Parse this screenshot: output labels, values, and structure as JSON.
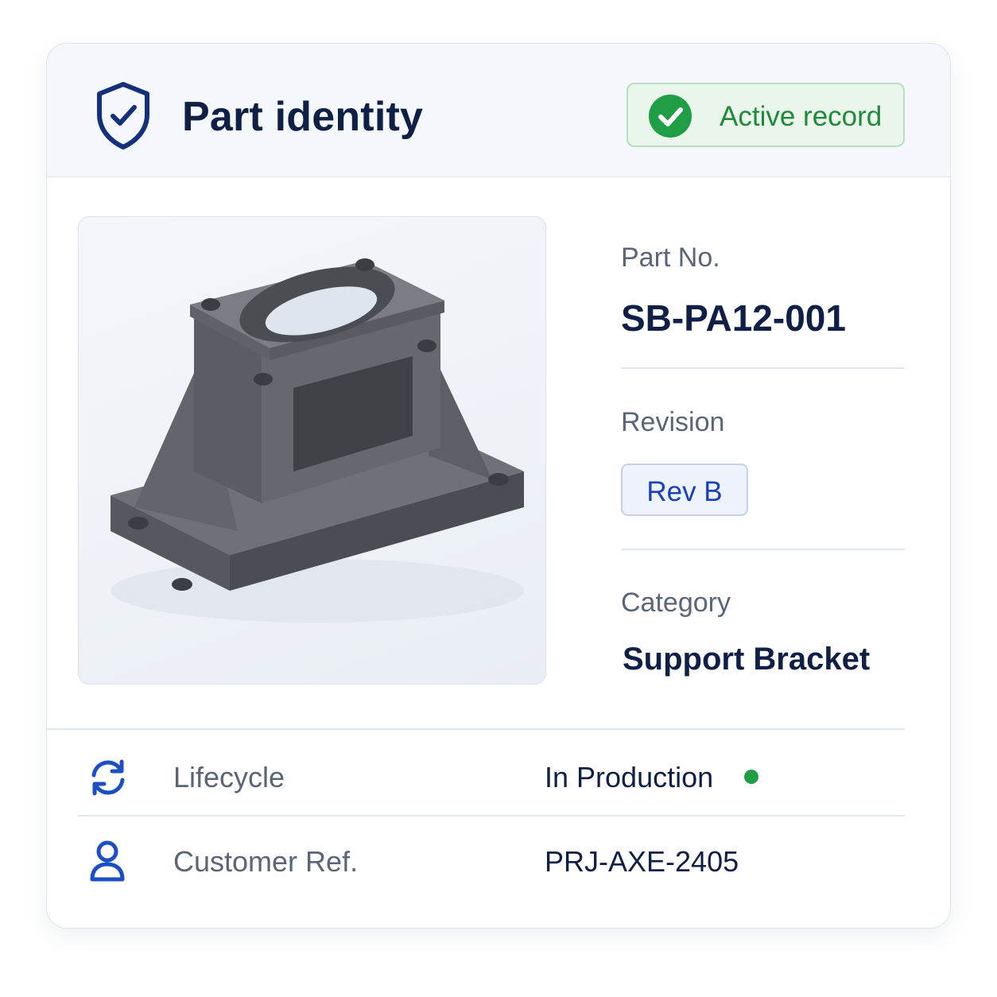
{
  "header": {
    "title": "Part identity",
    "status_badge": "Active record",
    "icons": {
      "title_icon": "shield-check-icon",
      "status_icon": "check-circle-icon"
    }
  },
  "image": {
    "alt": "Gray 3D-printed support bracket"
  },
  "fields": {
    "part_no": {
      "label": "Part No.",
      "value": "SB-PA12-001"
    },
    "revision": {
      "label": "Revision",
      "value": "Rev B"
    },
    "category": {
      "label": "Category",
      "value": "Support Bracket"
    }
  },
  "details": {
    "lifecycle": {
      "label": "Lifecycle",
      "value": "In Production",
      "icon": "refresh-icon"
    },
    "customer_ref": {
      "label": "Customer Ref.",
      "value": "PRJ-AXE-2405",
      "icon": "user-icon"
    }
  },
  "colors": {
    "navy": "#0f1f45",
    "accent_blue": "#1840c0",
    "success_green": "#1f9e45",
    "muted_text": "#5a6577"
  }
}
